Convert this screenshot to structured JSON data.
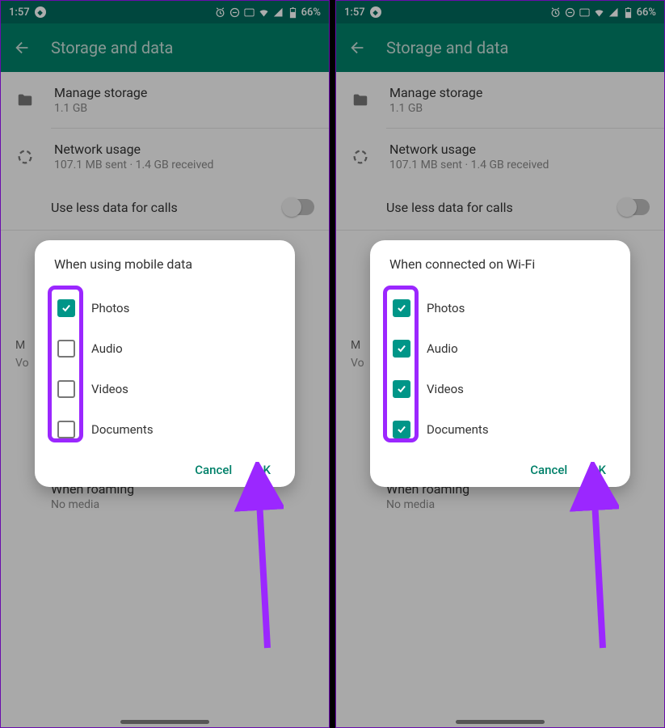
{
  "statusbar": {
    "time": "1:57",
    "battery": "66%"
  },
  "appbar": {
    "title": "Storage and data"
  },
  "settings": {
    "manage": {
      "title": "Manage storage",
      "sub": "1.1 GB"
    },
    "network": {
      "title": "Network usage",
      "sub": "107.1 MB sent · 1.4 GB received"
    },
    "useless": {
      "title": "Use less data for calls"
    },
    "roaming": {
      "title": "When roaming",
      "sub": "No media"
    },
    "media_letter": "M",
    "voice_letter": "Vo"
  },
  "dialog_left": {
    "title": "When using mobile data",
    "options": [
      {
        "label": "Photos",
        "checked": true
      },
      {
        "label": "Audio",
        "checked": false
      },
      {
        "label": "Videos",
        "checked": false
      },
      {
        "label": "Documents",
        "checked": false
      }
    ],
    "cancel": "Cancel",
    "ok": "OK"
  },
  "dialog_right": {
    "title": "When connected on Wi-Fi",
    "options": [
      {
        "label": "Photos",
        "checked": true
      },
      {
        "label": "Audio",
        "checked": true
      },
      {
        "label": "Videos",
        "checked": true
      },
      {
        "label": "Documents",
        "checked": true
      }
    ],
    "cancel": "Cancel",
    "ok": "OK"
  }
}
